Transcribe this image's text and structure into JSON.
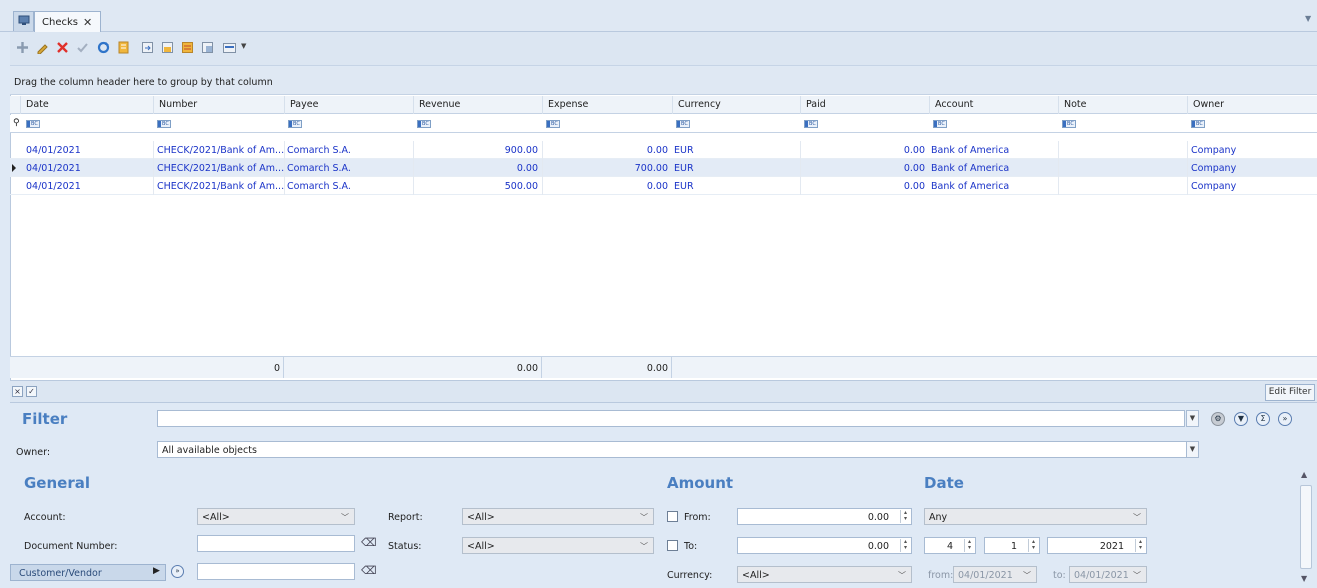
{
  "tabs": [
    {
      "label": "Checks",
      "close": "✕"
    }
  ],
  "toolbar": {
    "icons": [
      "add-icon",
      "edit-icon",
      "delete-icon",
      "check-icon",
      "refresh-icon",
      "document-icon",
      "export-icon",
      "import-icon",
      "print-icon",
      "report-icon",
      "layout-icon"
    ]
  },
  "grid": {
    "group_hint": "Drag the column header here to group by that column",
    "columns": [
      "Date",
      "Number",
      "Payee",
      "Revenue",
      "Expense",
      "Currency",
      "Paid",
      "Account",
      "Note",
      "Owner"
    ],
    "rows": [
      {
        "date": "04/01/2021",
        "number": "CHECK/2021/Bank of Am...",
        "payee": "Comarch S.A.",
        "revenue": "900.00",
        "expense": "0.00",
        "currency": "EUR",
        "paid": "0.00",
        "account": "Bank of America",
        "note": "",
        "owner": "Company"
      },
      {
        "date": "04/01/2021",
        "number": "CHECK/2021/Bank of Am...",
        "payee": "Comarch S.A.",
        "revenue": "0.00",
        "expense": "700.00",
        "currency": "EUR",
        "paid": "0.00",
        "account": "Bank of America",
        "note": "",
        "owner": "Company"
      },
      {
        "date": "04/01/2021",
        "number": "CHECK/2021/Bank of Am...",
        "payee": "Comarch S.A.",
        "revenue": "500.00",
        "expense": "0.00",
        "currency": "EUR",
        "paid": "0.00",
        "account": "Bank of America",
        "note": "",
        "owner": "Company"
      }
    ],
    "footer": {
      "count": "0",
      "revenue_total": "0.00",
      "expense_total": "0.00"
    }
  },
  "filterbar": {
    "edit_filter": "Edit Filter",
    "close": "×",
    "check": "✓"
  },
  "filter": {
    "title": "Filter",
    "value": "",
    "owner_label": "Owner:",
    "owner_value": "All available objects"
  },
  "general": {
    "title": "General",
    "account_label": "Account:",
    "account_value": "<All>",
    "docnum_label": "Document Number:",
    "docnum_value": "",
    "cv_label": "Customer/Vendor",
    "cv_value": "",
    "report_label": "Report:",
    "report_value": "<All>",
    "status_label": "Status:",
    "status_value": "<All>"
  },
  "amount": {
    "title": "Amount",
    "from_label": "From:",
    "from_value": "0.00",
    "to_label": "To:",
    "to_value": "0.00",
    "currency_label": "Currency:",
    "currency_value": "<All>"
  },
  "date": {
    "title": "Date",
    "range_value": "Any",
    "month": "4",
    "day": "1",
    "year": "2021",
    "from_label": "from:",
    "from_value": "04/01/2021",
    "to_label": "to:",
    "to_value": "04/01/2021"
  }
}
